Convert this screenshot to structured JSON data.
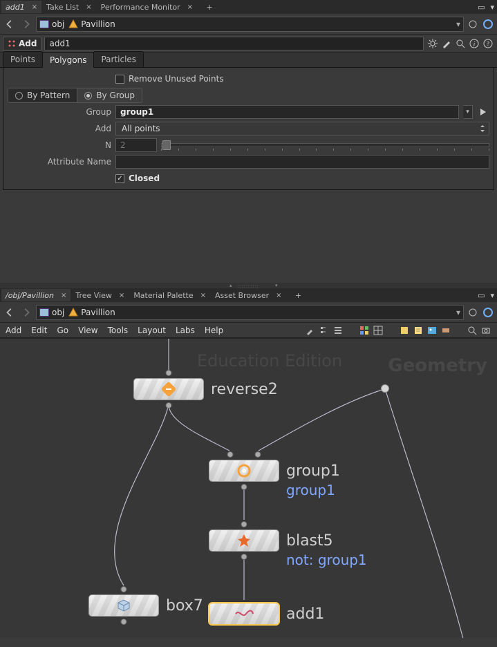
{
  "topTabs": {
    "items": [
      {
        "label": "add1",
        "active": true
      },
      {
        "label": "Take List",
        "active": false
      },
      {
        "label": "Performance Monitor",
        "active": false
      }
    ]
  },
  "path1": {
    "crumb_obj": "obj",
    "crumb_node": "Pavillion"
  },
  "op": {
    "type_label": "Add",
    "name": "add1"
  },
  "paramTabs": [
    "Points",
    "Polygons",
    "Particles"
  ],
  "paramTabs_active": 1,
  "params": {
    "remove_unused_label": "Remove Unused Points",
    "by_pattern_label": "By Pattern",
    "by_group_label": "By Group",
    "group_label": "Group",
    "group_value": "group1",
    "add_label": "Add",
    "add_value": "All points",
    "n_label": "N",
    "n_value": "2",
    "attr_label": "Attribute Name",
    "attr_value": "",
    "closed_label": "Closed"
  },
  "midTabs": {
    "items": [
      {
        "label": "/obj/Pavillion",
        "active": true
      },
      {
        "label": "Tree View",
        "active": false
      },
      {
        "label": "Material Palette",
        "active": false
      },
      {
        "label": "Asset Browser",
        "active": false
      }
    ]
  },
  "path2": {
    "crumb_obj": "obj",
    "crumb_node": "Pavillion"
  },
  "menus": [
    "Add",
    "Edit",
    "Go",
    "View",
    "Tools",
    "Layout",
    "Labs",
    "Help"
  ],
  "watermarks": {
    "edu": "Education Edition",
    "geo": "Geometry"
  },
  "nodes": {
    "reverse2": {
      "label": "reverse2"
    },
    "group1": {
      "label": "group1",
      "sub": "group1"
    },
    "blast5": {
      "label": "blast5",
      "sub": "not: group1"
    },
    "box7": {
      "label": "box7"
    },
    "add1": {
      "label": "add1"
    }
  }
}
